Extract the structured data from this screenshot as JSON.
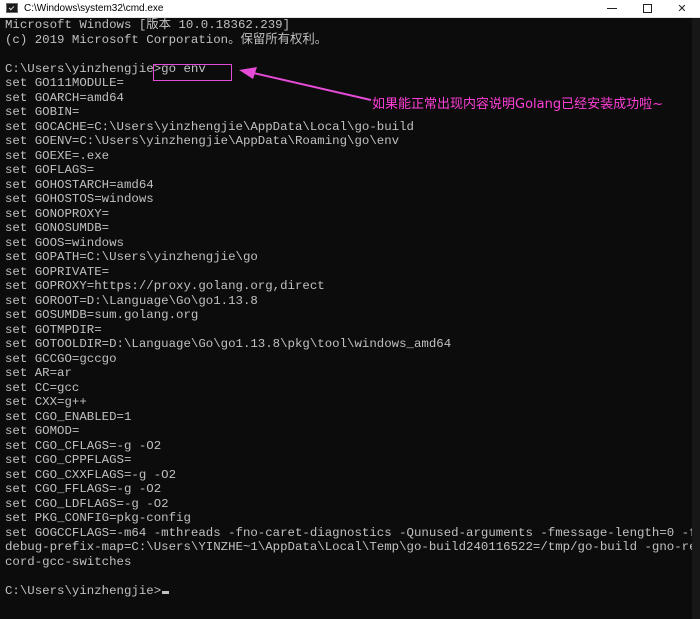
{
  "window": {
    "title": "C:\\Windows\\system32\\cmd.exe",
    "minimize_label": "—",
    "maximize_label": "☐",
    "close_label": "✕"
  },
  "console": {
    "lines": [
      "Microsoft Windows [版本 10.0.18362.239]",
      "(c) 2019 Microsoft Corporation。保留所有权利。",
      "",
      "C:\\Users\\yinzhengjie>go env",
      "set GO111MODULE=",
      "set GOARCH=amd64",
      "set GOBIN=",
      "set GOCACHE=C:\\Users\\yinzhengjie\\AppData\\Local\\go-build",
      "set GOENV=C:\\Users\\yinzhengjie\\AppData\\Roaming\\go\\env",
      "set GOEXE=.exe",
      "set GOFLAGS=",
      "set GOHOSTARCH=amd64",
      "set GOHOSTOS=windows",
      "set GONOPROXY=",
      "set GONOSUMDB=",
      "set GOOS=windows",
      "set GOPATH=C:\\Users\\yinzhengjie\\go",
      "set GOPRIVATE=",
      "set GOPROXY=https://proxy.golang.org,direct",
      "set GOROOT=D:\\Language\\Go\\go1.13.8",
      "set GOSUMDB=sum.golang.org",
      "set GOTMPDIR=",
      "set GOTOOLDIR=D:\\Language\\Go\\go1.13.8\\pkg\\tool\\windows_amd64",
      "set GCCGO=gccgo",
      "set AR=ar",
      "set CC=gcc",
      "set CXX=g++",
      "set CGO_ENABLED=1",
      "set GOMOD=",
      "set CGO_CFLAGS=-g -O2",
      "set CGO_CPPFLAGS=",
      "set CGO_CXXFLAGS=-g -O2",
      "set CGO_FFLAGS=-g -O2",
      "set CGO_LDFLAGS=-g -O2",
      "set PKG_CONFIG=pkg-config",
      "set GOGCCFLAGS=-m64 -mthreads -fno-caret-diagnostics -Qunused-arguments -fmessage-length=0 -f",
      "debug-prefix-map=C:\\Users\\YINZHE~1\\AppData\\Local\\Temp\\go-build240116522=/tmp/go-build -gno-re",
      "cord-gcc-switches",
      ""
    ],
    "prompt": "C:\\Users\\yinzhengjie>"
  },
  "annotation": {
    "text": "如果能正常出现内容说明Golang已经安装成功啦~",
    "color": "#ff3fd8"
  },
  "colors": {
    "console_bg": "#0c0c0c",
    "console_text": "#c0c0c0",
    "highlight": "#e54bd6"
  }
}
